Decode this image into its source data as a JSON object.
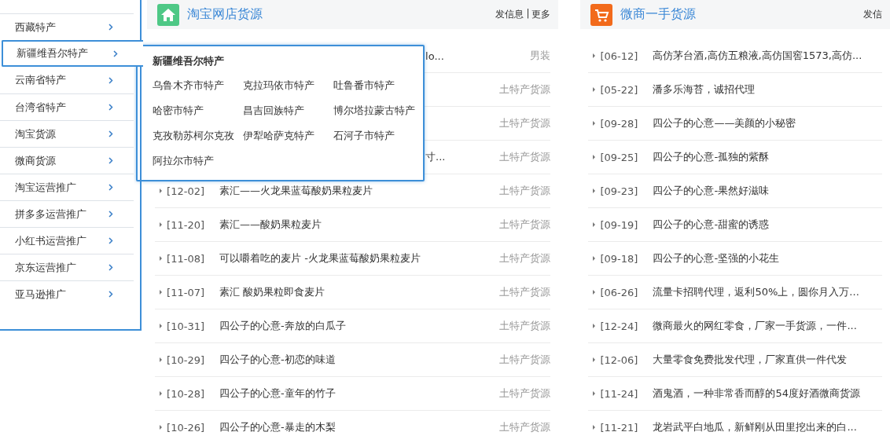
{
  "sidebar": {
    "items": [
      {
        "label": "西藏特产",
        "selected": false
      },
      {
        "label": "新疆维吾尔特产",
        "selected": true
      },
      {
        "label": "云南省特产",
        "selected": false
      },
      {
        "label": "台湾省特产",
        "selected": false
      },
      {
        "label": "淘宝货源",
        "selected": false
      },
      {
        "label": "微商货源",
        "selected": false
      },
      {
        "label": "淘宝运营推广",
        "selected": false
      },
      {
        "label": "拼多多运营推广",
        "selected": false
      },
      {
        "label": "小红书运营推广",
        "selected": false
      },
      {
        "label": "京东运营推广",
        "selected": false
      },
      {
        "label": "亚马逊推广",
        "selected": false
      }
    ]
  },
  "flyout": {
    "title": "新疆维吾尔特产",
    "links": [
      "乌鲁木齐市特产",
      "克拉玛依市特产",
      "吐鲁番市特产",
      "哈密市特产",
      "昌吉回族特产",
      "博尔塔拉蒙古特产",
      "克孜勒苏柯尔克孜",
      "伊犁哈萨克特产",
      "石河子市特产",
      "阿拉尔市特产"
    ]
  },
  "panels": [
    {
      "title": "淘宝网店货源",
      "actions": [
        "发信息",
        "更多"
      ],
      "separator": "|",
      "rows": [
        {
          "kind": "covered",
          "title": "lo...",
          "category": "男装"
        },
        {
          "kind": "covered",
          "category": "土特产货源"
        },
        {
          "kind": "covered",
          "category": "土特产货源"
        },
        {
          "kind": "covered",
          "title": "寸...",
          "category": "土特产货源"
        },
        {
          "kind": "full",
          "date": "[12-02]",
          "title": "素汇——火龙果蓝莓酸奶果粒麦片",
          "category": "土特产货源"
        },
        {
          "kind": "full",
          "date": "[11-20]",
          "title": "素汇——酸奶果粒麦片",
          "category": "土特产货源"
        },
        {
          "kind": "full",
          "date": "[11-08]",
          "title": "可以嚼着吃的麦片 -火龙果蓝莓酸奶果粒麦片",
          "category": "土特产货源"
        },
        {
          "kind": "full",
          "date": "[11-07]",
          "title": "素汇 酸奶果粒即食麦片",
          "category": "土特产货源"
        },
        {
          "kind": "full",
          "date": "[10-31]",
          "title": "四公子的心意-奔放的白瓜子",
          "category": "土特产货源"
        },
        {
          "kind": "full",
          "date": "[10-29]",
          "title": "四公子的心意-初恋的味道",
          "category": "土特产货源"
        },
        {
          "kind": "full",
          "date": "[10-28]",
          "title": "四公子的心意-童年的竹子",
          "category": "土特产货源"
        },
        {
          "kind": "full",
          "date": "[10-26]",
          "title": "四公子的心意-暴走的木梨",
          "category": "土特产货源"
        }
      ]
    },
    {
      "title": "微商一手货源",
      "actions": [
        "发信"
      ],
      "rows": [
        {
          "kind": "full",
          "date": "[06-12]",
          "title": "高仿茅台酒,高仿五粮液,高仿国窖1573,高仿..."
        },
        {
          "kind": "full",
          "date": "[05-22]",
          "title": "潘多乐海苔，诚招代理"
        },
        {
          "kind": "full",
          "date": "[09-28]",
          "title": "四公子的心意——美颜的小秘密"
        },
        {
          "kind": "full",
          "date": "[09-25]",
          "title": "四公子的心意-孤独的紫酥"
        },
        {
          "kind": "full",
          "date": "[09-23]",
          "title": "四公子的心意-果然好滋味"
        },
        {
          "kind": "full",
          "date": "[09-19]",
          "title": "四公子的心意-甜蜜的诱惑"
        },
        {
          "kind": "full",
          "date": "[09-18]",
          "title": "四公子的心意-坚强的小花生"
        },
        {
          "kind": "full",
          "date": "[06-26]",
          "title": "流量卡招聘代理，返利50%上，圆你月入万..."
        },
        {
          "kind": "full",
          "date": "[12-24]",
          "title": "微商最火的网红零食，厂家一手货源，一件..."
        },
        {
          "kind": "full",
          "date": "[12-06]",
          "title": "大量零食免费批发代理，厂家直供一件代发"
        },
        {
          "kind": "full",
          "date": "[11-24]",
          "title": "酒鬼酒，一种非常香而醇的54度好酒微商货源"
        },
        {
          "kind": "full",
          "date": "[11-21]",
          "title": "龙岩武平白地瓜，新鲜刚从田里挖出来的白..."
        }
      ]
    }
  ]
}
